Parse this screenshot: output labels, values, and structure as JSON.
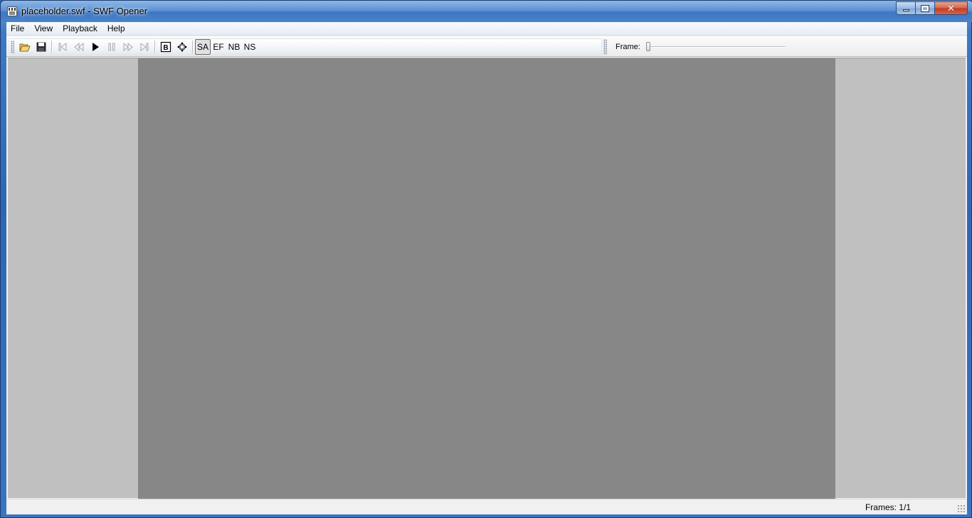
{
  "window": {
    "title": "placeholder.swf - SWF Opener",
    "caption": {
      "minimize": "",
      "maximize": "",
      "close": "✕"
    }
  },
  "menu": [
    "File",
    "View",
    "Playback",
    "Help"
  ],
  "toolbar": {
    "icons": [
      "open-folder-icon",
      "save-icon",
      "first-frame-icon",
      "rewind-icon",
      "play-icon",
      "pause-icon",
      "fast-forward-icon",
      "last-frame-icon",
      "border-icon",
      "fit-view-icon"
    ],
    "text_buttons": {
      "sa": "SA",
      "ef": "EF",
      "nb": "NB",
      "ns": "NS"
    },
    "border_label": "B"
  },
  "frame_bar": {
    "label": "Frame:",
    "slider_value": 0
  },
  "status": {
    "frames": "Frames: 1/1"
  },
  "colors": {
    "view_background": "#c0c0c0",
    "stage": "#878787"
  }
}
